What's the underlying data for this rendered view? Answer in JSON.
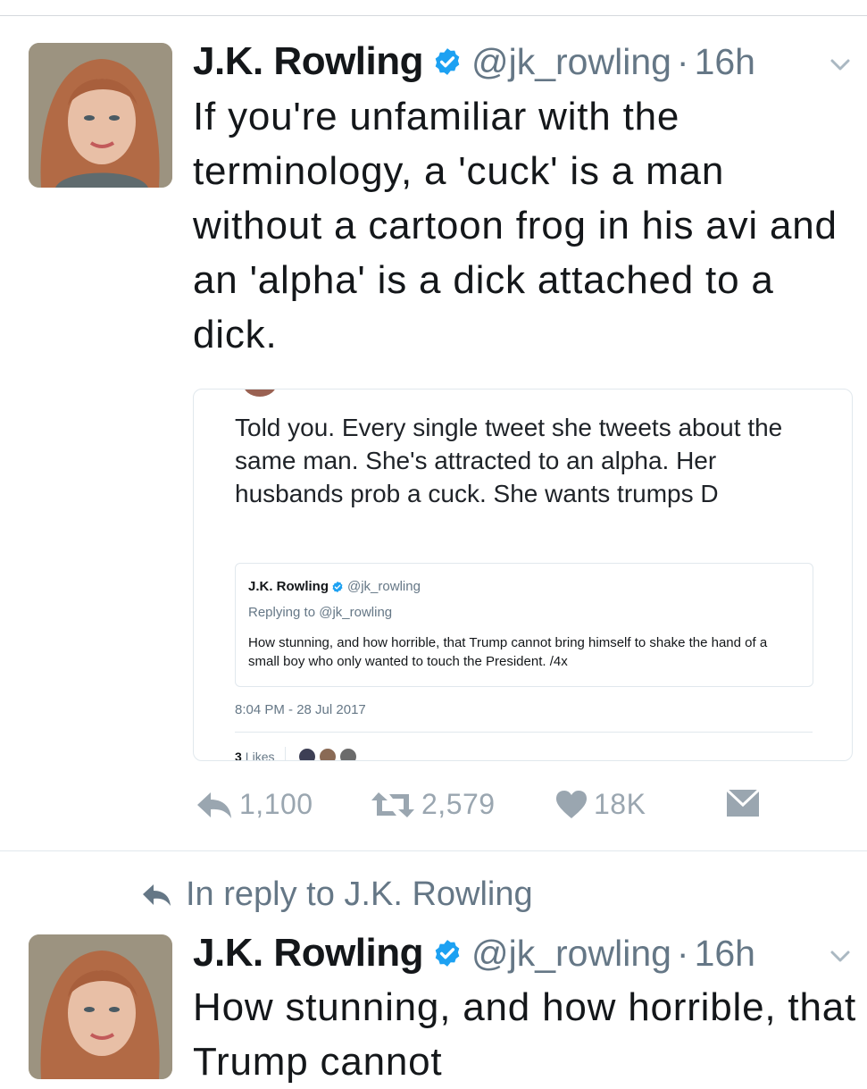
{
  "colors": {
    "verified": "#1da1f2",
    "secondary": "#657786",
    "action": "#9aa6b0",
    "text": "#14171a"
  },
  "tweet1": {
    "author_name": "J.K. Rowling",
    "handle": "@jk_rowling",
    "separator": "·",
    "time": "16h",
    "text": "If you're unfamiliar with the terminology, a 'cuck' is a man without a cartoon frog in his avi and an 'alpha' is a dick attached to a dick.",
    "quoted_screenshot": {
      "text": "Told you. Every single tweet she tweets about the same man. She's attracted to an alpha. Her husbands prob a cuck. She wants trumps D",
      "inner_author_name": "J.K. Rowling",
      "inner_handle": "@jk_rowling",
      "inner_replying": "Replying to @jk_rowling",
      "inner_text": "How stunning, and how horrible, that Trump cannot bring himself to shake the hand of a small boy who only wanted to touch the President. /4x",
      "date": "8:04 PM - 28 Jul 2017",
      "likes_count": "3",
      "likes_label": "Likes"
    },
    "actions": {
      "reply_icon": "reply-icon",
      "reply_count": "1,100",
      "retweet_icon": "retweet-icon",
      "retweet_count": "2,579",
      "like_icon": "heart-icon",
      "like_count": "18K",
      "dm_icon": "envelope-icon"
    }
  },
  "in_reply": {
    "icon": "reply-arrow-icon",
    "label": "In reply to J.K. Rowling"
  },
  "tweet2": {
    "author_name": "J.K. Rowling",
    "handle": "@jk_rowling",
    "separator": "·",
    "time": "16h",
    "text": "How stunning, and how horrible, that Trump cannot"
  }
}
